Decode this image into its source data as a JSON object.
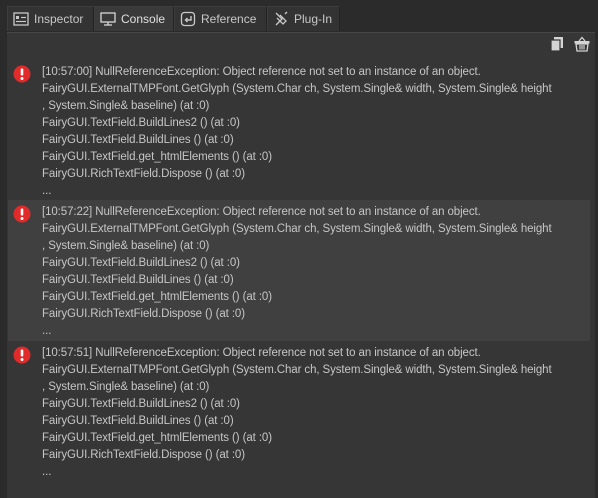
{
  "tabs": [
    {
      "label": "Inspector",
      "icon": "inspector-icon"
    },
    {
      "label": "Console",
      "icon": "monitor-icon",
      "active": true
    },
    {
      "label": "Reference",
      "icon": "reference-icon"
    },
    {
      "label": "Plug-In",
      "icon": "plugin-icon"
    }
  ],
  "toolbar": {
    "copy_icon": "copy-icon",
    "clear_icon": "clear-basket-icon"
  },
  "colors": {
    "error": "#e12b2b",
    "background": "#363636",
    "alt_row": "#404040"
  },
  "logs": [
    {
      "icon": "error-icon",
      "lines": [
        "[10:57:00] NullReferenceException: Object reference not set to an instance of an object.",
        "FairyGUI.ExternalTMPFont.GetGlyph (System.Char ch, System.Single& width, System.Single& height",
        ", System.Single& baseline) (at :0)",
        "FairyGUI.TextField.BuildLines2 () (at :0)",
        "FairyGUI.TextField.BuildLines () (at :0)",
        "FairyGUI.TextField.get_htmlElements () (at :0)",
        "FairyGUI.RichTextField.Dispose () (at :0)",
        "..."
      ]
    },
    {
      "icon": "error-icon",
      "lines": [
        "[10:57:22] NullReferenceException: Object reference not set to an instance of an object.",
        "FairyGUI.ExternalTMPFont.GetGlyph (System.Char ch, System.Single& width, System.Single& height",
        ", System.Single& baseline) (at :0)",
        "FairyGUI.TextField.BuildLines2 () (at :0)",
        "FairyGUI.TextField.BuildLines () (at :0)",
        "FairyGUI.TextField.get_htmlElements () (at :0)",
        "FairyGUI.RichTextField.Dispose () (at :0)",
        "..."
      ]
    },
    {
      "icon": "error-icon",
      "lines": [
        "[10:57:51] NullReferenceException: Object reference not set to an instance of an object.",
        "FairyGUI.ExternalTMPFont.GetGlyph (System.Char ch, System.Single& width, System.Single& height",
        ", System.Single& baseline) (at :0)",
        "FairyGUI.TextField.BuildLines2 () (at :0)",
        "FairyGUI.TextField.BuildLines () (at :0)",
        "FairyGUI.TextField.get_htmlElements () (at :0)",
        "FairyGUI.RichTextField.Dispose () (at :0)",
        "..."
      ]
    }
  ]
}
